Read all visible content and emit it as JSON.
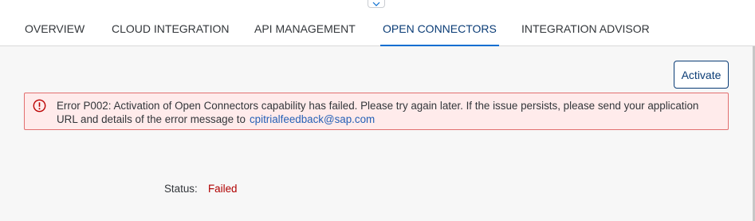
{
  "tabs": [
    {
      "label": "OVERVIEW",
      "selected": false
    },
    {
      "label": "CLOUD INTEGRATION",
      "selected": false
    },
    {
      "label": "API MANAGEMENT",
      "selected": false
    },
    {
      "label": "OPEN CONNECTORS",
      "selected": true
    },
    {
      "label": "INTEGRATION ADVISOR",
      "selected": false
    }
  ],
  "toolbar": {
    "activate_label": "Activate"
  },
  "error": {
    "icon": "error-circle-icon",
    "message": "Error P002: Activation of Open Connectors capability has failed. Please try again later. If the issue persists, please send your application URL and details of the error message to",
    "link": "cpitrialfeedback@sap.com"
  },
  "status": {
    "label": "Status:",
    "value": "Failed"
  },
  "colors": {
    "accent": "#0a6ed1",
    "selected_tab_text": "#0a3c76",
    "error_background": "#ffebeb",
    "error_border": "#e26f6f",
    "error_icon": "#bb0000",
    "link": "#2560b6",
    "status_failed": "#b00000"
  }
}
